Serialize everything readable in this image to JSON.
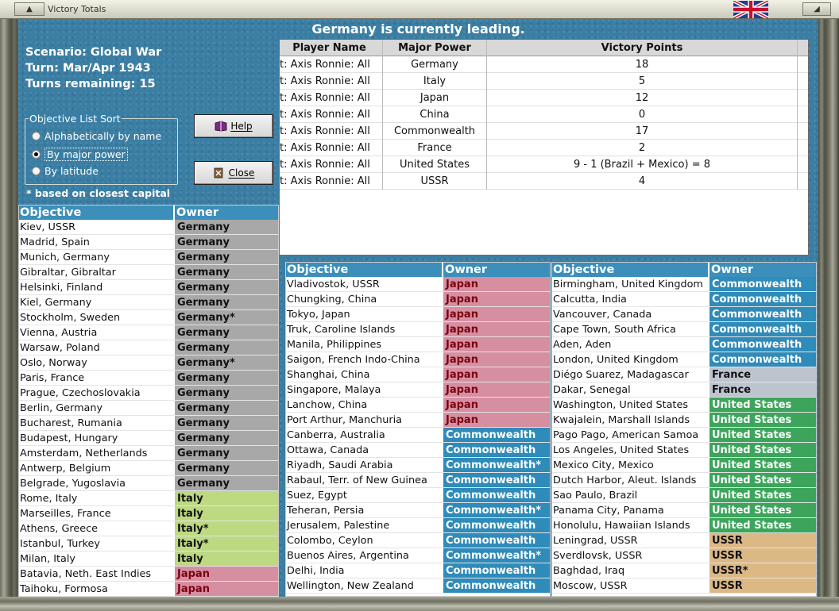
{
  "window": {
    "title": "Victory Totals"
  },
  "banner": "Germany is currently leading.",
  "info": {
    "scenario": "Scenario: Global War",
    "turn": "Turn: Mar/Apr 1943",
    "turns_remaining": "Turns remaining: 15"
  },
  "sort": {
    "legend": "Objective List Sort",
    "options": [
      "Alphabetically by name",
      "By major power",
      "By latitude"
    ],
    "selected": "By major power"
  },
  "buttons": {
    "help": "Help",
    "close": "Close"
  },
  "footnote": "* based on closest capital",
  "players": {
    "headers": [
      "Player Name",
      "Major Power",
      "Victory Points"
    ],
    "rows": [
      {
        "player": "t: Axis   Ronnie: All",
        "power": "Germany",
        "points": "18"
      },
      {
        "player": "t: Axis   Ronnie: All",
        "power": "Italy",
        "points": "5"
      },
      {
        "player": "t: Axis   Ronnie: All",
        "power": "Japan",
        "points": "12"
      },
      {
        "player": "t: Axis   Ronnie: All",
        "power": "China",
        "points": "0"
      },
      {
        "player": "t: Axis   Ronnie: All",
        "power": "Commonwealth",
        "points": "17"
      },
      {
        "player": "t: Axis   Ronnie: All",
        "power": "France",
        "points": "2"
      },
      {
        "player": "t: Axis   Ronnie: All",
        "power": "United States",
        "points": "9 - 1 (Brazil + Mexico) = 8"
      },
      {
        "player": "t: Axis   Ronnie: All",
        "power": "USSR",
        "points": "4"
      }
    ]
  },
  "objectives_header": {
    "objective": "Objective",
    "owner": "Owner"
  },
  "objective_lists": [
    [
      [
        "Kiev, USSR",
        "Germany"
      ],
      [
        "Madrid, Spain",
        "Germany"
      ],
      [
        "Munich, Germany",
        "Germany"
      ],
      [
        "Gibraltar, Gibraltar",
        "Germany"
      ],
      [
        "Helsinki, Finland",
        "Germany"
      ],
      [
        "Kiel, Germany",
        "Germany"
      ],
      [
        "Stockholm, Sweden",
        "Germany*"
      ],
      [
        "Vienna, Austria",
        "Germany"
      ],
      [
        "Warsaw, Poland",
        "Germany"
      ],
      [
        "Oslo, Norway",
        "Germany*"
      ],
      [
        "Paris, France",
        "Germany"
      ],
      [
        "Prague, Czechoslovakia",
        "Germany"
      ],
      [
        "Berlin, Germany",
        "Germany"
      ],
      [
        "Bucharest, Rumania",
        "Germany"
      ],
      [
        "Budapest, Hungary",
        "Germany"
      ],
      [
        "Amsterdam, Netherlands",
        "Germany"
      ],
      [
        "Antwerp, Belgium",
        "Germany"
      ],
      [
        "Belgrade, Yugoslavia",
        "Germany"
      ],
      [
        "Rome, Italy",
        "Italy"
      ],
      [
        "Marseilles, France",
        "Italy"
      ],
      [
        "Athens, Greece",
        "Italy*"
      ],
      [
        "Istanbul, Turkey",
        "Italy*"
      ],
      [
        "Milan, Italy",
        "Italy"
      ],
      [
        "Batavia, Neth. East Indies",
        "Japan"
      ],
      [
        "Taihoku, Formosa",
        "Japan"
      ]
    ],
    [
      [
        "Vladivostok, USSR",
        "Japan"
      ],
      [
        "Chungking, China",
        "Japan"
      ],
      [
        "Tokyo, Japan",
        "Japan"
      ],
      [
        "Truk, Caroline Islands",
        "Japan"
      ],
      [
        "Manila, Philippines",
        "Japan"
      ],
      [
        "Saigon, French Indo-China",
        "Japan"
      ],
      [
        "Shanghai, China",
        "Japan"
      ],
      [
        "Singapore, Malaya",
        "Japan"
      ],
      [
        "Lanchow, China",
        "Japan"
      ],
      [
        "Port Arthur, Manchuria",
        "Japan"
      ],
      [
        "Canberra, Australia",
        "Commonwealth"
      ],
      [
        "Ottawa, Canada",
        "Commonwealth"
      ],
      [
        "Riyadh, Saudi Arabia",
        "Commonwealth*"
      ],
      [
        "Rabaul, Terr. of New Guinea",
        "Commonwealth"
      ],
      [
        "Suez, Egypt",
        "Commonwealth"
      ],
      [
        "Teheran, Persia",
        "Commonwealth*"
      ],
      [
        "Jerusalem, Palestine",
        "Commonwealth"
      ],
      [
        "Colombo, Ceylon",
        "Commonwealth"
      ],
      [
        "Buenos Aires, Argentina",
        "Commonwealth*"
      ],
      [
        "Delhi, India",
        "Commonwealth"
      ],
      [
        "Wellington, New Zealand",
        "Commonwealth"
      ]
    ],
    [
      [
        "Birmingham, United Kingdom",
        "Commonwealth"
      ],
      [
        "Calcutta, India",
        "Commonwealth"
      ],
      [
        "Vancouver, Canada",
        "Commonwealth"
      ],
      [
        "Cape Town, South Africa",
        "Commonwealth"
      ],
      [
        "Aden, Aden",
        "Commonwealth"
      ],
      [
        "London, United Kingdom",
        "Commonwealth"
      ],
      [
        "Diégo Suarez, Madagascar",
        "France"
      ],
      [
        "Dakar, Senegal",
        "France"
      ],
      [
        "Washington, United States",
        "United States"
      ],
      [
        "Kwajalein, Marshall Islands",
        "United States"
      ],
      [
        "Pago Pago, American Samoa",
        "United States"
      ],
      [
        "Los Angeles, United States",
        "United States"
      ],
      [
        "Mexico City, Mexico",
        "United States"
      ],
      [
        "Dutch Harbor, Aleut. Islands",
        "United States"
      ],
      [
        "Sao Paulo, Brazil",
        "United States"
      ],
      [
        "Panama City, Panama",
        "United States"
      ],
      [
        "Honolulu, Hawaiian Islands",
        "United States"
      ],
      [
        "Leningrad, USSR",
        "USSR"
      ],
      [
        "Sverdlovsk, USSR",
        "USSR"
      ],
      [
        "Baghdad, Iraq",
        "USSR*"
      ],
      [
        "Moscow, USSR",
        "USSR"
      ]
    ]
  ]
}
